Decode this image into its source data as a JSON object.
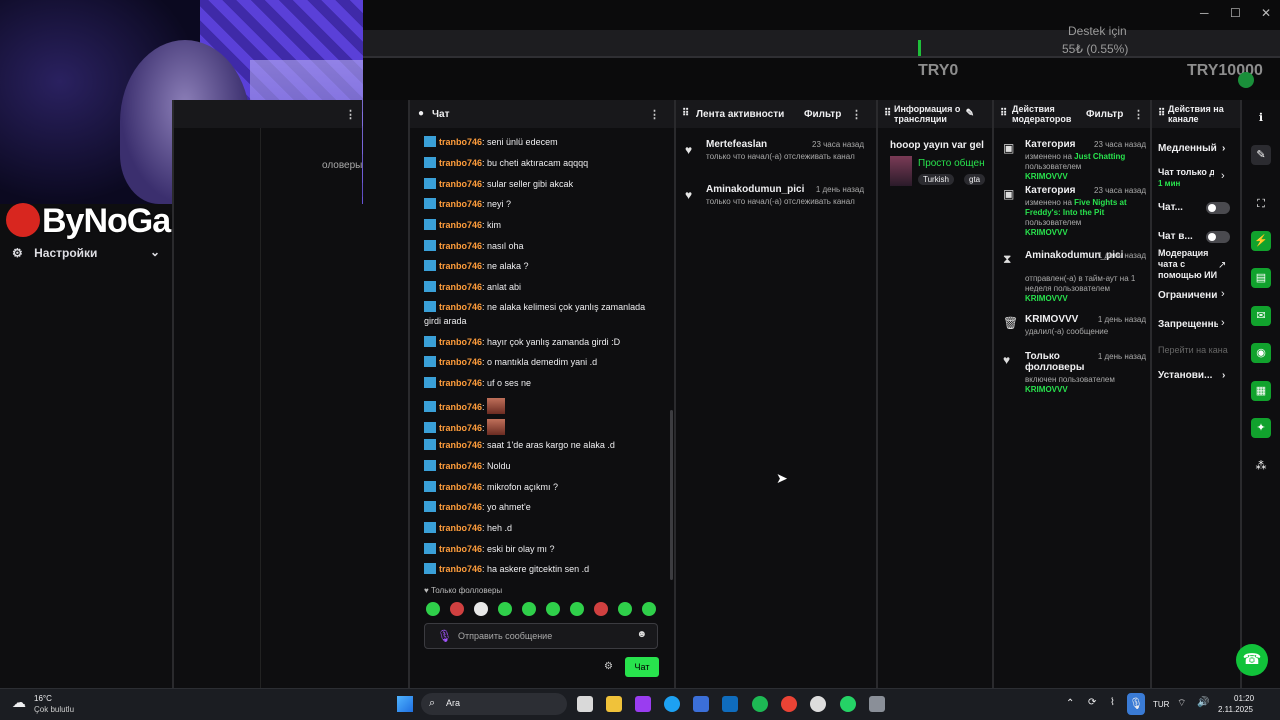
{
  "stream": {
    "support_label": "Destek için",
    "progress_text": "55₺ (0.55%)",
    "goal_current": "TRY0",
    "goal_target": "TRY10000",
    "logo_text": "ByNoGame",
    "settings_label": "Настройки",
    "followers_label": "оловеры"
  },
  "chat": {
    "title": "Чат",
    "messages": [
      {
        "user": "tranbo746",
        "text": "seni ünlü edecem"
      },
      {
        "user": "tranbo746",
        "text": "bu cheti aktıracam aqqqq"
      },
      {
        "user": "tranbo746",
        "text": "sular seller gibi akcak"
      },
      {
        "user": "tranbo746",
        "text": "neyi ?"
      },
      {
        "user": "tranbo746",
        "text": "kim"
      },
      {
        "user": "tranbo746",
        "text": "nasıl oha"
      },
      {
        "user": "tranbo746",
        "text": "ne alaka ?"
      },
      {
        "user": "tranbo746",
        "text": "anlat abi"
      },
      {
        "user": "tranbo746",
        "text": "ne alaka kelimesi çok yanlış zamanlada"
      },
      {
        "user": "",
        "text": "girdi arada"
      },
      {
        "user": "tranbo746",
        "text": "hayır çok yanlış zamanda girdi :D"
      },
      {
        "user": "tranbo746",
        "text": "o mantıkla demedim yani .d"
      },
      {
        "user": "tranbo746",
        "text": "uf o ses ne"
      },
      {
        "user": "tranbo746",
        "text": ""
      },
      {
        "user": "tranbo746",
        "text": ""
      },
      {
        "user": "tranbo746",
        "text": "saat 1'de aras kargo ne alaka .d"
      },
      {
        "user": "tranbo746",
        "text": "Noldu"
      },
      {
        "user": "tranbo746",
        "text": "mikrofon açıkmı ?"
      },
      {
        "user": "tranbo746",
        "text": "yo ahmet'e"
      },
      {
        "user": "tranbo746",
        "text": "heh .d"
      },
      {
        "user": "tranbo746",
        "text": "eski bir olay mı ?"
      },
      {
        "user": "tranbo746",
        "text": "ha askere gitcektin sen .d"
      }
    ],
    "followers_only": "Только фолловеры",
    "input_placeholder": "Отправить сообщение",
    "send_label": "Чат"
  },
  "activity": {
    "title": "Лента активности",
    "filter": "Фильтр",
    "items": [
      {
        "name": "Mertefeaslan",
        "time": "23 часа назад",
        "desc": "только что начал(-а) отслеживать канал"
      },
      {
        "name": "Aminakodumun_pici",
        "time": "1 день назад",
        "desc": "только что начал(-а) отслеживать канал"
      }
    ]
  },
  "stream_info": {
    "title": "Информация о трансляции",
    "stream_title": "hooop yayın var gel",
    "category": "Просто общен",
    "tags": [
      "Turkish",
      "gta"
    ]
  },
  "mod_actions": {
    "title": "Действия модераторов",
    "filter": "Фильтр",
    "items": [
      {
        "icon": "category-icon",
        "title": "Категория",
        "time": "23 часа назад",
        "desc_pre": "изменено на",
        "desc_green": "Just Chatting",
        "desc_post": "пользователем",
        "user": "KRIMOVVV"
      },
      {
        "icon": "category-icon",
        "title": "Категория",
        "time": "23 часа назад",
        "desc_pre": "изменено на",
        "desc_green": "Five Nights at Freddy's: Into the Pit",
        "desc_post": "пользователем",
        "user": "KRIMOVVV"
      },
      {
        "icon": "timeout-icon",
        "title": "Aminakodumun_pici",
        "time": "1 день назад",
        "desc_pre": "отправлен(-а) в тайм-аут на 1 неделя пользователем",
        "desc_green": "",
        "desc_post": "",
        "user": "KRIMOVVV"
      },
      {
        "icon": "trash-icon",
        "title": "KRIMOVVV",
        "time": "1 день назад",
        "desc_pre": "удалил(-а) сообщение",
        "desc_green": "",
        "desc_post": "",
        "user": ""
      },
      {
        "icon": "heart-icon",
        "title": "Только фолловеры",
        "time": "1 день назад",
        "desc_pre": "включен пользователем",
        "desc_green": "",
        "desc_post": "",
        "user": "KRIMOVVV"
      }
    ]
  },
  "channel_actions": {
    "title": "Действия на канале",
    "rows": [
      "Медленный",
      "Чат только д",
      "1 мин",
      "Чат...",
      "Чат в...",
      "Модерация чата с помощью ИИ",
      "Ограничени",
      "Запрещенны",
      "Перейти на кана",
      "Установи..."
    ]
  },
  "taskbar": {
    "weather_temp": "16°C",
    "weather_desc": "Çok bulutlu",
    "search_label": "Ara",
    "lang": "TUR",
    "time": "01:20",
    "date": "2.11.2025"
  },
  "colors": {
    "accent": "#28e24d",
    "username": "#ff9d3c",
    "background": "#0e0e10"
  }
}
